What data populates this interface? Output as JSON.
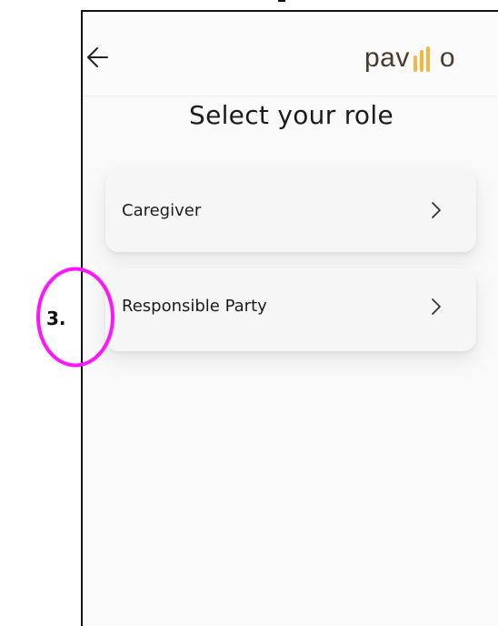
{
  "header": {
    "back_icon": "arrow-left-icon",
    "logo": {
      "text_start": "pav",
      "text_end": "o",
      "bars_icon": "logo-bars-icon",
      "bar_colors": [
        "#f1b844",
        "#f1b844",
        "#f1b844"
      ]
    }
  },
  "page": {
    "title": "Select your role"
  },
  "roles": [
    {
      "label": "Caregiver",
      "icon": "chevron-right-icon"
    },
    {
      "label": "Responsible Party",
      "icon": "chevron-right-icon"
    }
  ],
  "annotation": {
    "label": "3.",
    "color": "#ff14ff"
  },
  "colors": {
    "background": "#f9f9fa",
    "card": "#f6f6f7",
    "logo_text": "#4a3a2e",
    "logo_accent": "#f1b844"
  }
}
